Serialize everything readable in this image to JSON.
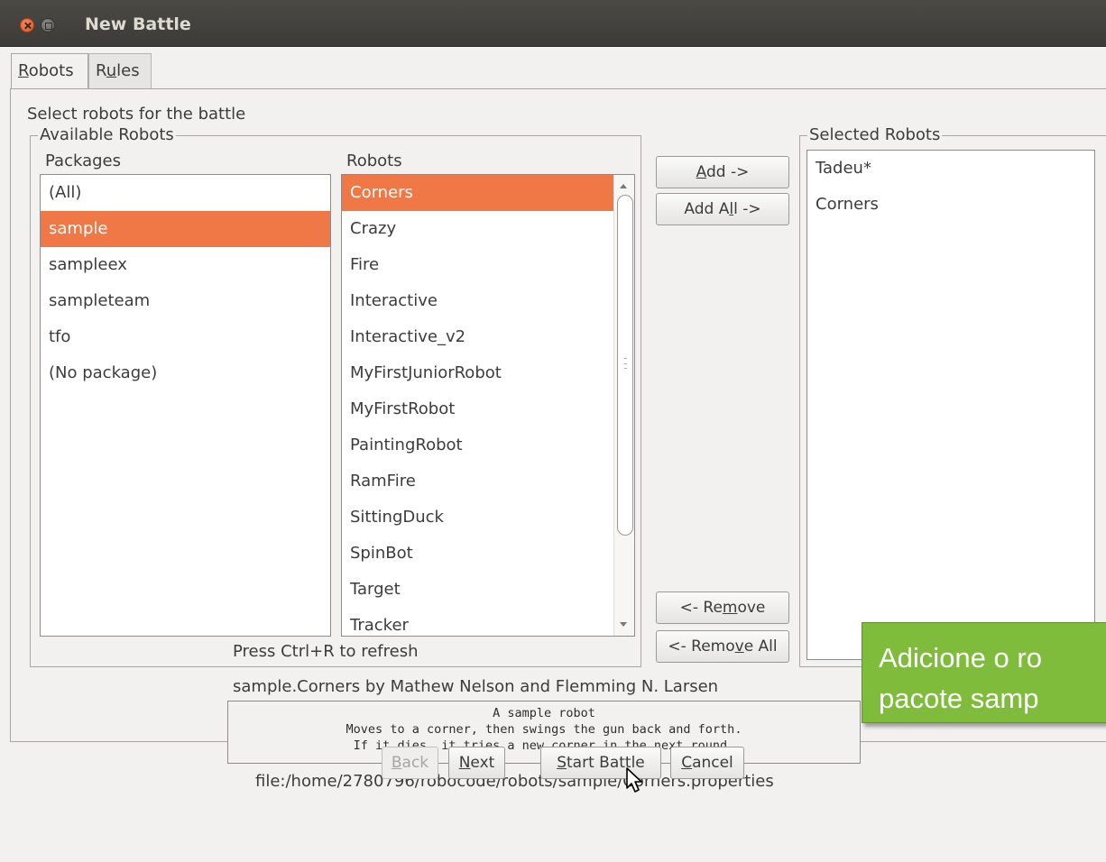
{
  "window": {
    "title": "New Battle"
  },
  "tabs": [
    {
      "label_u": "R",
      "label_rest": "obots"
    },
    {
      "label_pre": "R",
      "label_u": "u",
      "label_rest": "les"
    }
  ],
  "robots_tab": {
    "instruction": "Select robots for the battle",
    "available_legend": "Available Robots",
    "packages_header": "Packages",
    "robots_header": "Robots",
    "packages": [
      "(All)",
      "sample",
      "sampleex",
      "sampleteam",
      "tfo",
      "(No package)"
    ],
    "selected_package_index": 1,
    "robots": [
      "Corners",
      "Crazy",
      "Fire",
      "Interactive",
      "Interactive_v2",
      "MyFirstJuniorRobot",
      "MyFirstRobot",
      "PaintingRobot",
      "RamFire",
      "SittingDuck",
      "SpinBot",
      "Target",
      "Tracker"
    ],
    "selected_robot_index": 0,
    "refresh_hint": "Press Ctrl+R to refresh",
    "selected_legend": "Selected Robots",
    "selected_robots": [
      "Tadeu*",
      "Corners"
    ],
    "buttons": {
      "add": {
        "u": "A",
        "rest": "dd ->"
      },
      "add_all": {
        "pre": "Add A",
        "u": "l",
        "rest": "l ->"
      },
      "remove": {
        "pre": "<- Re",
        "u": "m",
        "rest": "ove"
      },
      "remove_all": {
        "pre": "<- Remo",
        "u": "v",
        "rest": "e All"
      }
    },
    "robot_author": "sample.Corners by Mathew Nelson and Flemming N. Larsen",
    "robot_description": [
      "A sample robot",
      "Moves to a corner, then swings the gun back and forth.",
      "If it dies, it tries a new corner in the next round."
    ],
    "robot_file": "file:/home/2780796/robocode/robots/sample/Corners.properties"
  },
  "wizard_buttons": {
    "back": {
      "u": "B",
      "rest": "ack"
    },
    "next": {
      "u": "N",
      "rest": "ext"
    },
    "start": {
      "u": "S",
      "rest": "tart Battle"
    },
    "cancel": {
      "u": "C",
      "rest": "ancel"
    }
  },
  "overlay_hint": {
    "line1": "Adicione o ro",
    "line2": "pacote samp"
  },
  "colors": {
    "selection": "#f07746",
    "hint_bg": "#7fbc3c",
    "titlebar": "#3c3b37"
  }
}
